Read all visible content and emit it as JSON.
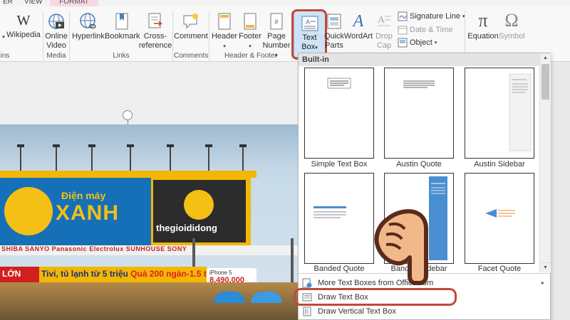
{
  "tabs": {
    "left_partial": "ER",
    "view": "VIEW",
    "format": "FORMAT"
  },
  "ribbon": {
    "addins_partial": "ins",
    "wikipedia": "Wikipedia",
    "online_video": [
      "Online",
      "Video"
    ],
    "media_group": "Media",
    "hyperlink": "Hyperlink",
    "bookmark": "Bookmark",
    "cross_reference": [
      "Cross-",
      "reference"
    ],
    "links_group": "Links",
    "comment": "Comment",
    "comments_group": "Comments",
    "header": "Header",
    "footer": "Footer",
    "page_number": [
      "Page",
      "Number"
    ],
    "header_footer_group": "Header & Footer",
    "text_box": [
      "Text",
      "Box"
    ],
    "quick_parts": [
      "Quick",
      "Parts"
    ],
    "wordart": "WordArt",
    "drop_cap": [
      "Drop",
      "Cap"
    ],
    "signature_line": "Signature Line",
    "date_time": "Date & Time",
    "object": "Object",
    "equation": "Equation",
    "symbol": "Symbol"
  },
  "gallery": {
    "heading": "Built-in",
    "items": [
      "Simple Text Box",
      "Austin Quote",
      "Austin Sidebar",
      "Banded Quote",
      "Banded Sidebar",
      "Facet Quote"
    ],
    "menu": [
      "More Text Boxes from Office.com",
      "Draw Text Box",
      "Draw Vertical Text Box"
    ]
  },
  "photo": {
    "brand1_top": "Điện máy",
    "brand1_main": "XANH",
    "brand2": "thegioididong",
    "logo_strip": "SHIBA SANYO Panasonic Electrolux SUNHOUSE SONY",
    "promo_red": "LỚN",
    "promo_text": "Tivi, tủ lạnh từ 5 triệu",
    "promo_red2": "Quà 200 ngàn",
    "promo_tail": "-1.5 triệ",
    "iphone_line1": "iPhone 5",
    "iphone_price": "8.490.000"
  },
  "colors": {
    "highlight_ring": "#c0493a",
    "selected_button": "#cfe3f6",
    "brand_yellow": "#f2b705",
    "brand_blue": "#1670b8"
  }
}
